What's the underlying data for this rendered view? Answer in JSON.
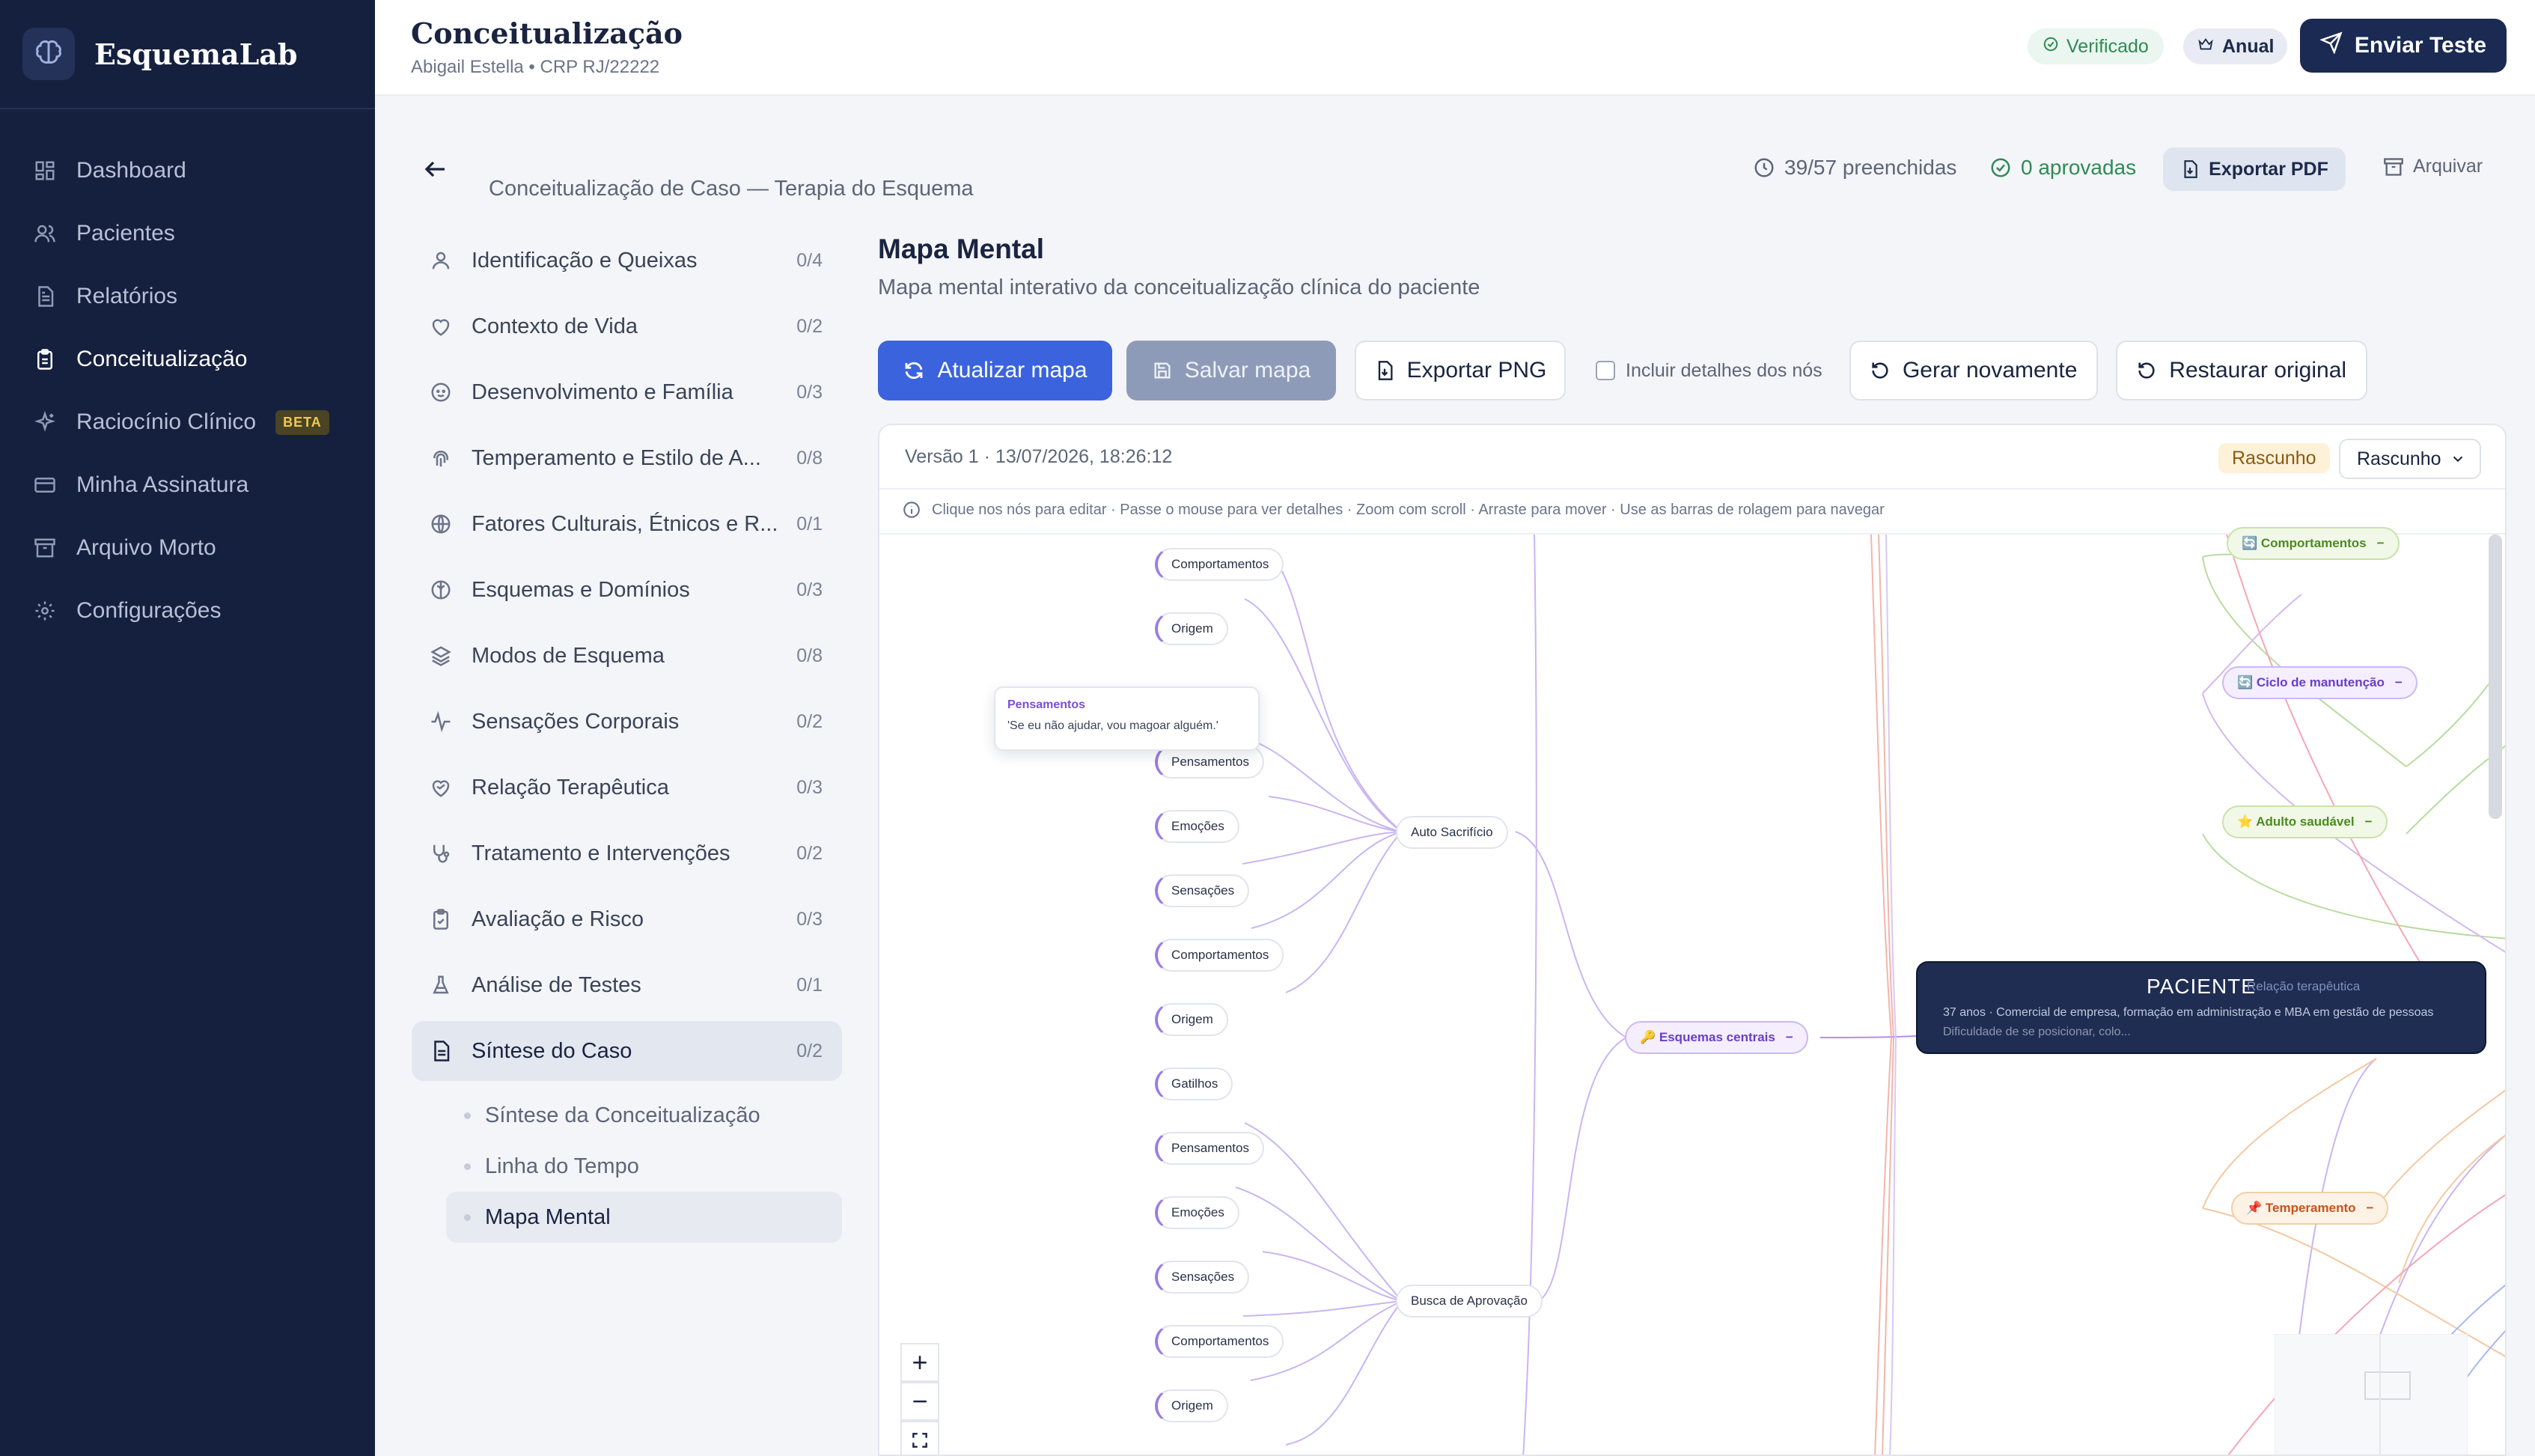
{
  "brand": {
    "name": "EsquemaLab"
  },
  "sidebar": {
    "items": [
      {
        "label": "Dashboard"
      },
      {
        "label": "Pacientes"
      },
      {
        "label": "Relatórios"
      },
      {
        "label": "Conceitualização"
      },
      {
        "label": "Raciocínio Clínico",
        "badge": "BETA"
      },
      {
        "label": "Minha Assinatura"
      },
      {
        "label": "Arquivo Morto"
      },
      {
        "label": "Configurações"
      }
    ]
  },
  "header": {
    "title": "Conceitualização",
    "subtitle": "Abigail Estella • CRP RJ/22222",
    "verified": "Verificado",
    "plan": "Anual",
    "send_button": "Enviar Teste"
  },
  "case": {
    "title": "Conceitualização de Caso — Terapia do Esquema",
    "filled": "39/57 preenchidas",
    "approved": "0 aprovadas",
    "export_pdf": "Exportar PDF",
    "archive": "Arquivar"
  },
  "sections": [
    {
      "label": "Identificação e Queixas",
      "count": "0/4"
    },
    {
      "label": "Contexto de Vida",
      "count": "0/2"
    },
    {
      "label": "Desenvolvimento e Família",
      "count": "0/3"
    },
    {
      "label": "Temperamento e Estilo de A...",
      "count": "0/8"
    },
    {
      "label": "Fatores Culturais, Étnicos e R...",
      "count": "0/1"
    },
    {
      "label": "Esquemas e Domínios",
      "count": "0/3"
    },
    {
      "label": "Modos de Esquema",
      "count": "0/8"
    },
    {
      "label": "Sensações Corporais",
      "count": "0/2"
    },
    {
      "label": "Relação Terapêutica",
      "count": "0/3"
    },
    {
      "label": "Tratamento e Intervenções",
      "count": "0/2"
    },
    {
      "label": "Avaliação e Risco",
      "count": "0/3"
    },
    {
      "label": "Análise de Testes",
      "count": "0/1"
    },
    {
      "label": "Síntese do Caso",
      "count": "0/2"
    }
  ],
  "subsections": [
    {
      "label": "Síntese da Conceitualização"
    },
    {
      "label": "Linha do Tempo"
    },
    {
      "label": "Mapa Mental"
    }
  ],
  "main": {
    "title": "Mapa Mental",
    "subtitle": "Mapa mental interativo da conceitualização clínica do paciente",
    "toolbar": {
      "update": "Atualizar mapa",
      "save": "Salvar mapa",
      "export_png": "Exportar PNG",
      "include_details": "Incluir detalhes dos nós",
      "regenerate": "Gerar novamente",
      "restore": "Restaurar original"
    }
  },
  "map": {
    "version": "Versão 1",
    "datetime": "13/07/2026, 18:26:12",
    "status_pill": "Rascunho",
    "status_select": "Rascunho",
    "hint": "Clique nos nós para editar · Passe o mouse para ver detalhes · Zoom com scroll · Arraste para mover · Use as barras de rolagem para navegar",
    "leaf_nodes": {
      "comportamentos": "Comportamentos",
      "origem": "Origem",
      "pensamentos": "Pensamentos",
      "emocoes": "Emoções",
      "sensacoes": "Sensações",
      "gatilhos": "Gatilhos"
    },
    "mid_nodes": {
      "auto_sacrificio": "Auto Sacrifício",
      "busca_aprovacao": "Busca de Aprovação"
    },
    "hub_nodes": {
      "esquemas_centrais": "🔑 Esquemas centrais",
      "comportamentos": "🔄 Comportamentos",
      "ciclo": "🔄 Ciclo de manutenção",
      "adulto": "⭐ Adulto saudável",
      "temperamento": "📌 Temperamento"
    },
    "collapse_symbol": "−",
    "tooltip": {
      "title": "Pensamentos",
      "body": "'Se eu não ajudar, vou magoar alguém.'"
    },
    "patient": {
      "title": "PACIENTE",
      "line1": "37 anos · Comercial de empresa, formação em administração e MBA em gestão de pessoas",
      "line2": "Dificuldade de se posicionar, colo...",
      "overlay": "Relação terapêutica"
    },
    "zoom": {
      "in": "+",
      "out": "−"
    }
  }
}
